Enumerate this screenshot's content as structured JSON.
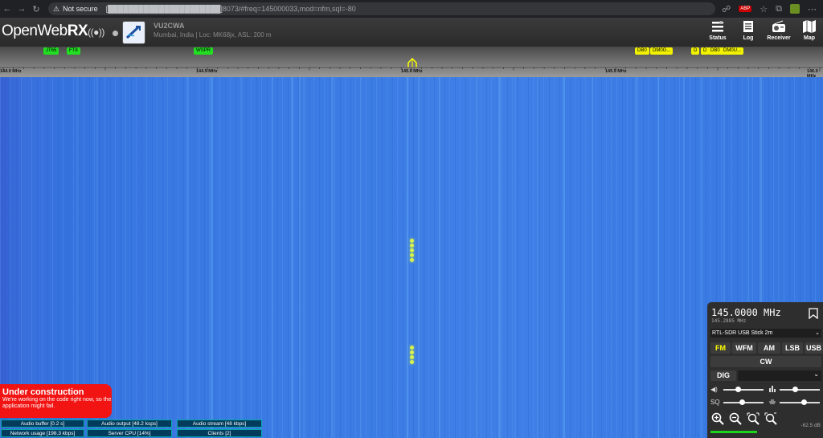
{
  "browser": {
    "security": "Not secure",
    "url_host": "[██████████████████████]",
    "url_path": "8073/#freq=145000033,mod=nfm,sql=-80"
  },
  "header": {
    "logo_text": "OpenWeb",
    "logo_bold": "RX",
    "callsign": "VU2CWA",
    "location": "Mumbai, India | Loc: MK68jx, ASL: 200 m",
    "nav": [
      {
        "label": "Status"
      },
      {
        "label": "Log"
      },
      {
        "label": "Receiver"
      },
      {
        "label": "Map"
      }
    ]
  },
  "scale": {
    "tags_green": [
      "JT65",
      "FT8",
      "WSPR"
    ],
    "tags_yellow": [
      "DB0",
      "DM0G...",
      "D",
      "D",
      "DB0",
      "DM0U..."
    ],
    "freq_labels": [
      "144.0 MHz",
      "144.5 MHz",
      "145.0 MHz",
      "145.5 MHz",
      "146.0 MHz"
    ]
  },
  "notice": {
    "title": "Under construction",
    "message": "We're working on the code right now, so the application might fail."
  },
  "status": {
    "audio_buffer": "Audio buffer [0.2 s]",
    "audio_output": "Audio output [48.2 ksps]",
    "audio_stream": "Audio stream [48 kbps]",
    "network_usage": "Network usage [198.3 kbps]",
    "server_cpu": "Server CPU [14%]",
    "clients": "Clients [2]"
  },
  "receiver": {
    "frequency": "145.0000 MHz",
    "sub_frequency": "145.2885 MHz",
    "sdr_profile": "RTL-SDR USB Stick 2m",
    "modes": [
      "FM",
      "WFM",
      "AM",
      "LSB",
      "USB"
    ],
    "mode_cw": "CW",
    "mode_dig": "DIG",
    "active_mode": "FM",
    "volume_label": "◀)",
    "squelch_label": "SQ",
    "volume_level": 0.35,
    "squelch_level": 0.45,
    "level_db": "-62.5 dB",
    "signal_fraction": 0.42
  },
  "colors": {
    "waterfall": "#3b7ce4",
    "notice_bg": "#f21313",
    "tag_green": "#22dd22",
    "tag_yellow": "#f2f200",
    "active_mode": "#ffff00"
  }
}
